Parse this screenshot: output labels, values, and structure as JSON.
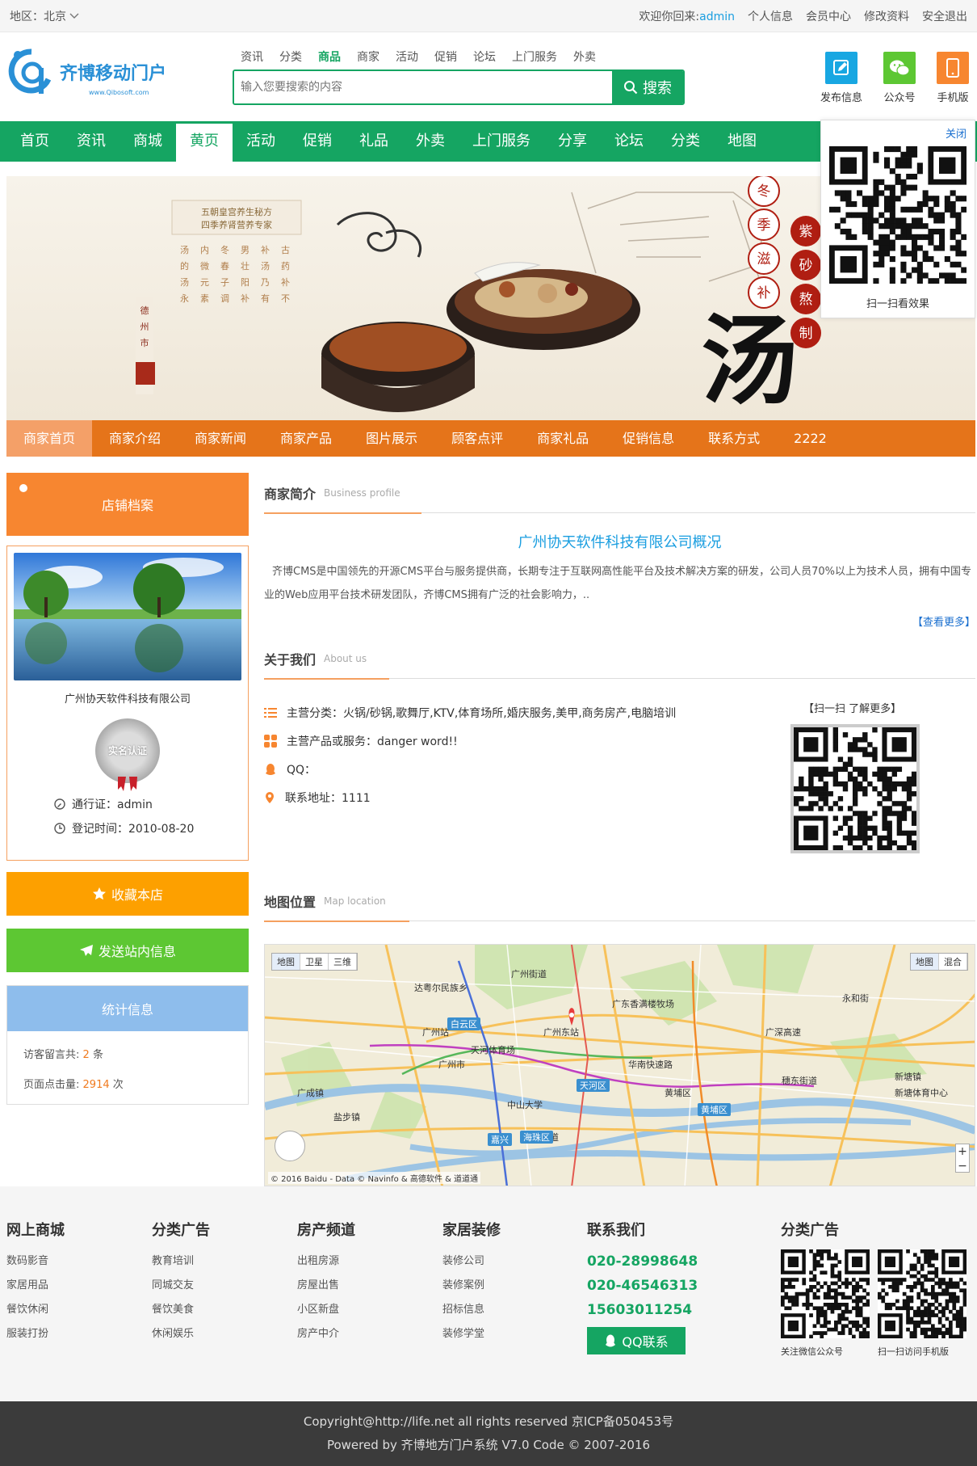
{
  "topbar": {
    "region": "地区：北京",
    "welcome_prefix": "欢迎你回来:",
    "username": "admin",
    "links": [
      "个人信息",
      "会员中心",
      "修改资料",
      "安全退出"
    ]
  },
  "header": {
    "logo_title": "齐博移动门户",
    "logo_url": "www.Qibosoft.com",
    "search_categories": [
      "资讯",
      "分类",
      "商品",
      "商家",
      "活动",
      "促销",
      "论坛",
      "上门服务",
      "外卖"
    ],
    "search_active": "商品",
    "search_placeholder": "输入您要搜索的内容",
    "search_button": "搜索",
    "icons": [
      {
        "label": "发布信息",
        "icon": "edit-icon",
        "color": "#18a7e2"
      },
      {
        "label": "公众号",
        "icon": "wechat-icon",
        "color": "#5dc733"
      },
      {
        "label": "手机版",
        "icon": "mobile-icon",
        "color": "#f78630"
      }
    ]
  },
  "mainnav": {
    "items": [
      "首页",
      "资讯",
      "商城",
      "黄页",
      "活动",
      "促销",
      "礼品",
      "外卖",
      "上门服务",
      "分享",
      "论坛",
      "分类",
      "地图"
    ],
    "active": "黄页"
  },
  "qrfloat": {
    "close": "关闭",
    "caption": "扫一扫看效果"
  },
  "banner": {
    "tagline1": "五朝皇宫养生秘方",
    "tagline2": "四季养肾营养专家",
    "badges": [
      "冬",
      "季",
      "滋",
      "补"
    ],
    "badges2": [
      "紫",
      "砂",
      "熬",
      "制"
    ],
    "big_char": "汤"
  },
  "shopnav": {
    "items": [
      "商家首页",
      "商家介绍",
      "商家新闻",
      "商家产品",
      "图片展示",
      "顾客点评",
      "商家礼品",
      "促销信息",
      "联系方式",
      "2222"
    ],
    "active": "商家首页"
  },
  "left": {
    "archive_button": "店铺档案",
    "company_name": "广州协天软件科技有限公司",
    "badge_text": "实名认证",
    "pass_label": "通行证：admin",
    "register_label": "登记时间：2010-08-20",
    "fav_button": "收藏本店",
    "msg_button": "发送站内信息",
    "stats_title": "统计信息",
    "stats_msg_prefix": "访客留言共:",
    "stats_msg_count": "2",
    "stats_msg_suffix": "条",
    "stats_hits_prefix": "页面点击量:",
    "stats_hits_count": "2914",
    "stats_hits_suffix": "次"
  },
  "intro": {
    "title_zh": "商家简介",
    "title_en": "Business profile",
    "heading": "广州协天软件科技有限公司概况",
    "paragraph": "齐博CMS是中国领先的开源CMS平台与服务提供商，长期专注于互联网高性能平台及技术解决方案的研发，公司人员70%以上为技术人员，拥有中国专业的Web应用平台技术研发团队，齐博CMS拥有广泛的社会影响力，..",
    "more": "【查看更多】"
  },
  "about": {
    "title_zh": "关于我们",
    "title_en": "About us",
    "items": [
      {
        "icon": "list-icon",
        "text": "主营分类：火锅/砂锅,歌舞厅,KTV,体育场所,婚庆服务,美甲,商务房产,电脑培训"
      },
      {
        "icon": "grid-icon",
        "text": "主营产品或服务：danger word!!"
      },
      {
        "icon": "qq-icon",
        "text": "QQ："
      },
      {
        "icon": "location-icon",
        "text": "联系地址：1111"
      }
    ],
    "qr_caption": "【扫一扫 了解更多】"
  },
  "maploc": {
    "title_zh": "地图位置",
    "title_en": "Map location",
    "type_left": [
      "地图",
      "卫星",
      "三维"
    ],
    "type_right": [
      "地图",
      "混合"
    ],
    "labels": [
      "广州市",
      "广州站",
      "广州东站",
      "天河体育场",
      "达粤尔民族乡",
      "广州街道",
      "广东香满楼牧场",
      "永和街",
      "新塘镇",
      "新塘体育中心",
      "穗东街道",
      "广深高速",
      "华南快速路",
      "中山大学",
      "华洲街道",
      "盐步镇",
      "广成镇",
      "黄埔区"
    ],
    "districts": [
      "白云区",
      "天河区",
      "嘉兴",
      "海珠区",
      "黄埔区"
    ],
    "copyright": "© 2016 Baidu - Data © Navinfo & 高德软件 & 道道通"
  },
  "footer": {
    "columns": [
      {
        "title": "网上商城",
        "links": [
          "数码影音",
          "家居用品",
          "餐饮休闲",
          "服装打扮"
        ]
      },
      {
        "title": "分类广告",
        "links": [
          "教育培训",
          "同城交友",
          "餐饮美食",
          "休闲娱乐"
        ]
      },
      {
        "title": "房产频道",
        "links": [
          "出租房源",
          "房屋出售",
          "小区新盘",
          "房产中介"
        ]
      },
      {
        "title": "家居装修",
        "links": [
          "装修公司",
          "装修案例",
          "招标信息",
          "装修学堂"
        ]
      }
    ],
    "contact_title": "联系我们",
    "phones": [
      "020-28998648",
      "020-46546313",
      "15603011254"
    ],
    "qq_button": "QQ联系",
    "qr_title": "分类广告",
    "qr_captions": [
      "关注微信公众号",
      "扫一扫访问手机版"
    ]
  },
  "copyright": {
    "line1": "Copyright@http://life.net all rights reserved 京ICP备050453号",
    "line2": "Powered by 齐博地方门户系统 V7.0 Code © 2007-2016"
  }
}
